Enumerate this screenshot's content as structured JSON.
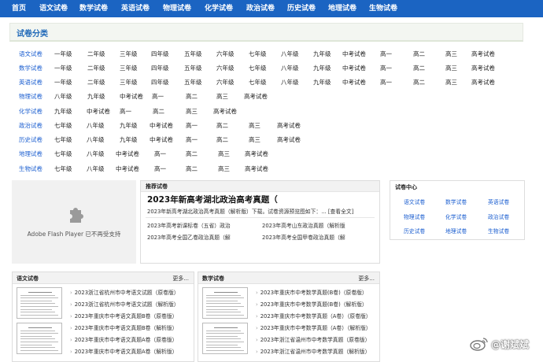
{
  "nav": [
    "首页",
    "语文试卷",
    "数学试卷",
    "英语试卷",
    "物理试卷",
    "化学试卷",
    "政治试卷",
    "历史试卷",
    "地理试卷",
    "生物试卷"
  ],
  "category_title": "试卷分类",
  "grade_rows": [
    {
      "label": "语文试卷",
      "items": [
        "一年级",
        "二年级",
        "三年级",
        "四年级",
        "五年级",
        "六年级",
        "七年级",
        "八年级",
        "九年级",
        "中考试卷",
        "高一",
        "高二",
        "高三",
        "高考试卷"
      ]
    },
    {
      "label": "数学试卷",
      "items": [
        "一年级",
        "二年级",
        "三年级",
        "四年级",
        "五年级",
        "六年级",
        "七年级",
        "八年级",
        "九年级",
        "中考试卷",
        "高一",
        "高二",
        "高三",
        "高考试卷"
      ]
    },
    {
      "label": "英语试卷",
      "items": [
        "一年级",
        "二年级",
        "三年级",
        "四年级",
        "五年级",
        "六年级",
        "七年级",
        "八年级",
        "九年级",
        "中考试卷",
        "高一",
        "高二",
        "高三",
        "高考试卷"
      ]
    },
    {
      "label": "物理试卷",
      "items": [
        "八年级",
        "九年级",
        "中考试卷",
        "高一",
        "高二",
        "高三",
        "高考试卷"
      ]
    },
    {
      "label": "化学试卷",
      "items": [
        "九年级",
        "中考试卷",
        "高一",
        "高二",
        "高三",
        "高考试卷"
      ]
    },
    {
      "label": "政治试卷",
      "items": [
        "七年级",
        "八年级",
        "九年级",
        "中考试卷",
        "高一",
        "高二",
        "高三",
        "高考试卷"
      ]
    },
    {
      "label": "历史试卷",
      "items": [
        "七年级",
        "八年级",
        "九年级",
        "中考试卷",
        "高一",
        "高二",
        "高三",
        "高考试卷"
      ]
    },
    {
      "label": "地理试卷",
      "items": [
        "七年级",
        "八年级",
        "中考试卷",
        "高一",
        "高二",
        "高三",
        "高考试卷"
      ]
    },
    {
      "label": "生物试卷",
      "items": [
        "七年级",
        "八年级",
        "中考试卷",
        "高一",
        "高二",
        "高三",
        "高考试卷"
      ]
    }
  ],
  "flash": {
    "text": "Adobe Flash Player 已不再受支持",
    "icon": "puzzle-piece-icon"
  },
  "recommend": {
    "header": "推荐试卷",
    "title": "2023年新高考湖北政治高考真题（",
    "desc": "2023年新高考湖北政治高考真题（解析版）下载。试卷资源预览图如下：...",
    "more": "[查看全文]",
    "links": [
      "2023年高考新课标卷（五省）政治",
      "2023年高考山东政治真题（解析版",
      "2023年高考全国乙卷政治真题（解",
      "2023年高考全国甲卷政治真题（解"
    ]
  },
  "center": {
    "title": "试卷中心",
    "links": [
      "语文试卷",
      "数学试卷",
      "英语试卷",
      "物理试卷",
      "化学试卷",
      "政治试卷",
      "历史试卷",
      "地理试卷",
      "生物试卷"
    ]
  },
  "panels": [
    {
      "title": "语文试卷",
      "more": "更多...",
      "links": [
        "2023浙江省杭州市中考语文试题（原卷版）",
        "2023浙江省杭州市中考语文试题（解析版）",
        "2023年重庆市中考语文真题B卷（原卷版）",
        "2023年重庆市中考语文真题B卷（解析版）",
        "2023年重庆市中考语文真题A卷（原卷版）",
        "2023年重庆市中考语文真题A卷（解析版）"
      ]
    },
    {
      "title": "数学试卷",
      "more": "更多...",
      "links": [
        "2023年重庆市中考数学真题(B卷)（原卷版）",
        "2023年重庆市中考数学真题(B卷)（解析版）",
        "2023年重庆市中考数学真题（A卷）（原卷版）",
        "2023年重庆市中考数学真题（A卷）（解析版）",
        "2023年浙江省温州市中考数学真题（原卷版）",
        "2023年浙江省温州市中考数学真题（解析版）"
      ]
    }
  ],
  "watermark": "@谢斌斌",
  "colors": {
    "nav_bg": "#1b64c2",
    "link_blue": "#1c5fd0"
  }
}
